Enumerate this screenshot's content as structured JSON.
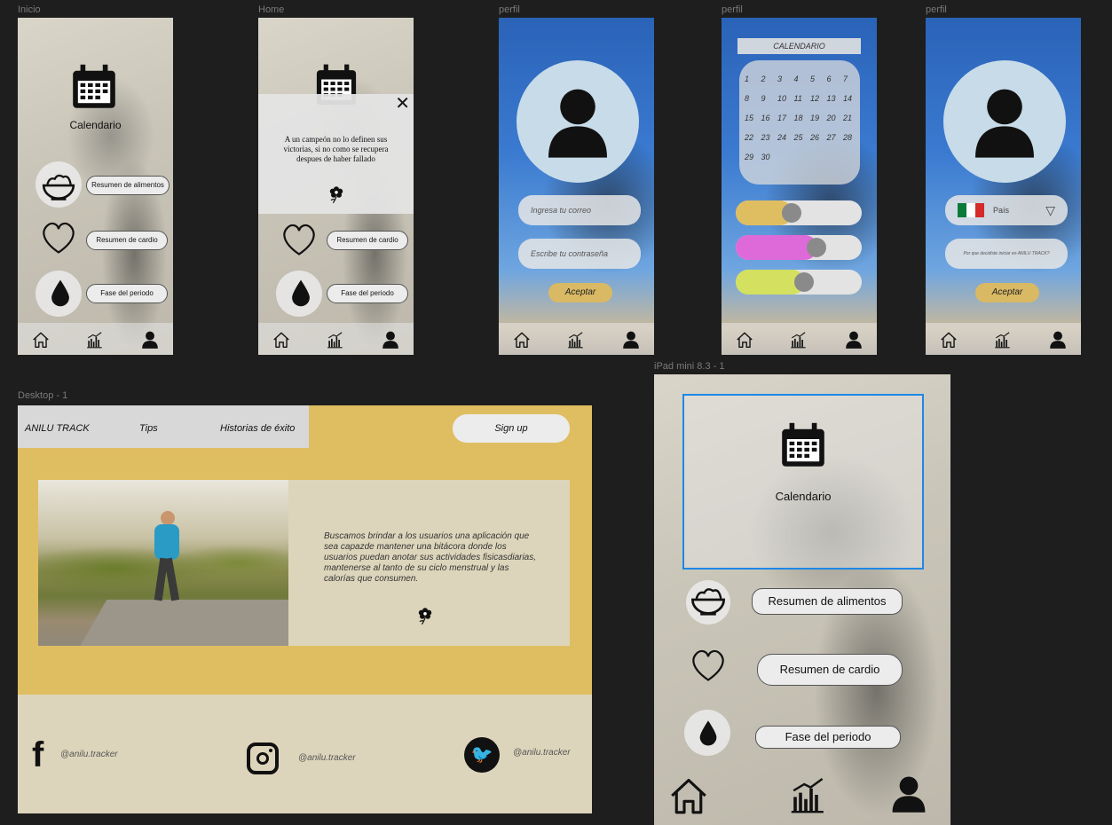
{
  "frames": {
    "inicio": {
      "label": "Inicio"
    },
    "home": {
      "label": "Home"
    },
    "perfil1": {
      "label": "perfil"
    },
    "perfil2": {
      "label": "perfil"
    },
    "perfil3": {
      "label": "perfil"
    },
    "desktop": {
      "label": "Desktop - 1"
    },
    "ipad": {
      "label": "iPad mini 8.3 - 1"
    }
  },
  "mobile": {
    "calendar_label": "Calendario",
    "food_summary": "Resumen de alimentos",
    "cardio_summary": "Resumen de cardio",
    "period_phase": "Fase del periodo",
    "quote": "A un campeón no lo definen sus victorias, si no como se recupera despues de haber fallado"
  },
  "login": {
    "email_placeholder": "Ingresa tu correo",
    "password_placeholder": "Escribe tu contraseña",
    "accept": "Aceptar"
  },
  "calendar": {
    "title": "CALENDARIO",
    "days": [
      "1",
      "2",
      "3",
      "4",
      "5",
      "6",
      "7",
      "8",
      "9",
      "10",
      "11",
      "12",
      "13",
      "14",
      "15",
      "16",
      "17",
      "18",
      "19",
      "20",
      "21",
      "22",
      "23",
      "24",
      "25",
      "26",
      "27",
      "28",
      "29",
      "30"
    ]
  },
  "profile": {
    "country": "País",
    "question": "Por que decidiste iniciar en ANILU TRACK?",
    "accept": "Aceptar"
  },
  "desktop": {
    "brand": "ANILU TRACK",
    "nav_tips": "Tips",
    "nav_stories": "Historias de éxito",
    "signup": "Sign up",
    "description": "Buscamos brindar a los usuarios una aplicación que sea capazde mantener una bitácora donde los usuarios puedan anotar sus actividades fisicasdiarias, mantenerse al tanto de su ciclo menstrual y las calorías que consumen.",
    "handle_facebook": "@anilu.tracker",
    "handle_instagram": "@anilu.tracker",
    "handle_twitter": "@anilu.tracker"
  },
  "ipad": {
    "calendar_label": "Calendario",
    "food_summary": "Resumen de alimentos",
    "cardio_summary": "Resumen de cardio",
    "period_phase": "Fase del periodo"
  },
  "colors": {
    "gold": "#dfbe62",
    "beige": "#ddd5bb",
    "selection": "#1e88e5"
  }
}
